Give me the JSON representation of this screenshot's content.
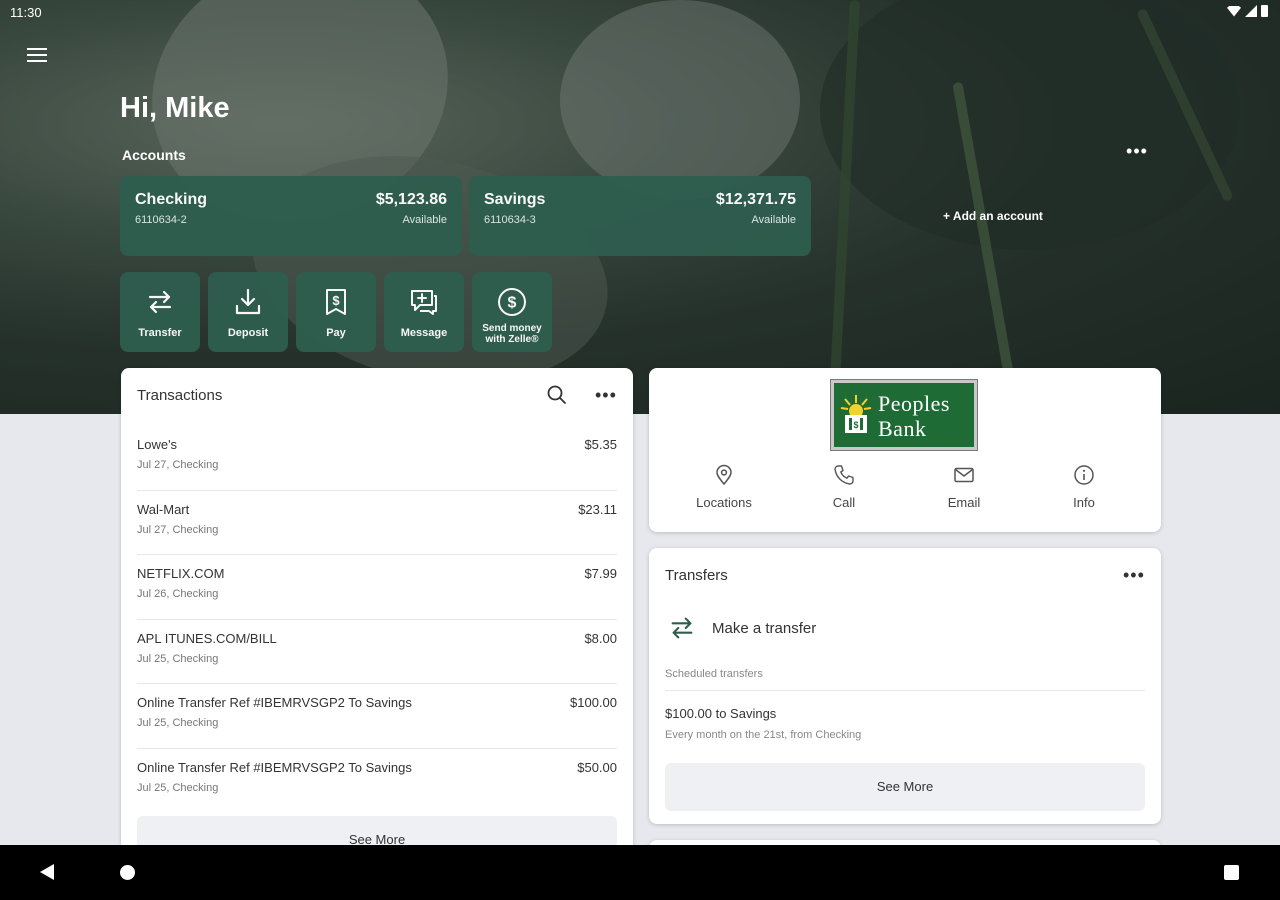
{
  "status_bar": {
    "time": "11:30"
  },
  "header": {
    "greeting": "Hi, Mike",
    "accounts_label": "Accounts",
    "more_icon": "more-horizontal-icon",
    "add_account": "+ Add an account"
  },
  "accounts": [
    {
      "name": "Checking",
      "number": "6110634-2",
      "balance": "$5,123.86",
      "balance_note": "Available"
    },
    {
      "name": "Savings",
      "number": "6110634-3",
      "balance": "$12,371.75",
      "balance_note": "Available"
    }
  ],
  "quick_actions": [
    {
      "label": "Transfer",
      "icon": "transfer-arrows-icon"
    },
    {
      "label": "Deposit",
      "icon": "download-icon"
    },
    {
      "label": "Pay",
      "icon": "bill-dollar-icon"
    },
    {
      "label": "Message",
      "icon": "message-plus-icon"
    },
    {
      "label": "Send money with Zelle®",
      "icon": "dollar-circle-icon"
    }
  ],
  "transactions": {
    "title": "Transactions",
    "see_more": "See More",
    "items": [
      {
        "merchant": "Lowe's",
        "amount": "$5.35",
        "detail": "Jul 27, Checking"
      },
      {
        "merchant": "Wal-Mart",
        "amount": "$23.11",
        "detail": "Jul 27, Checking"
      },
      {
        "merchant": "NETFLIX.COM",
        "amount": "$7.99",
        "detail": "Jul 26, Checking"
      },
      {
        "merchant": "APL ITUNES.COM/BILL",
        "amount": "$8.00",
        "detail": "Jul 25, Checking"
      },
      {
        "merchant": "Online Transfer Ref #IBEMRVSGP2 To Savings",
        "amount": "$100.00",
        "detail": "Jul 25, Checking"
      },
      {
        "merchant": "Online Transfer Ref #IBEMRVSGP2 To Savings",
        "amount": "$50.00",
        "detail": "Jul 25, Checking"
      }
    ]
  },
  "bank": {
    "logo_line1": "Peoples",
    "logo_line2": "Bank",
    "accent_color": "#1f6b35",
    "actions": [
      {
        "label": "Locations",
        "icon": "map-pin-icon"
      },
      {
        "label": "Call",
        "icon": "phone-icon"
      },
      {
        "label": "Email",
        "icon": "mail-icon"
      },
      {
        "label": "Info",
        "icon": "info-icon"
      }
    ]
  },
  "transfers": {
    "title": "Transfers",
    "make_transfer": "Make a transfer",
    "scheduled_label": "Scheduled transfers",
    "scheduled_title": "$100.00 to Savings",
    "scheduled_detail": "Every month on the 21st, from Checking",
    "see_more": "See More"
  },
  "colors": {
    "card_green": "#2e5d4e",
    "background": "#e6e8ed"
  }
}
